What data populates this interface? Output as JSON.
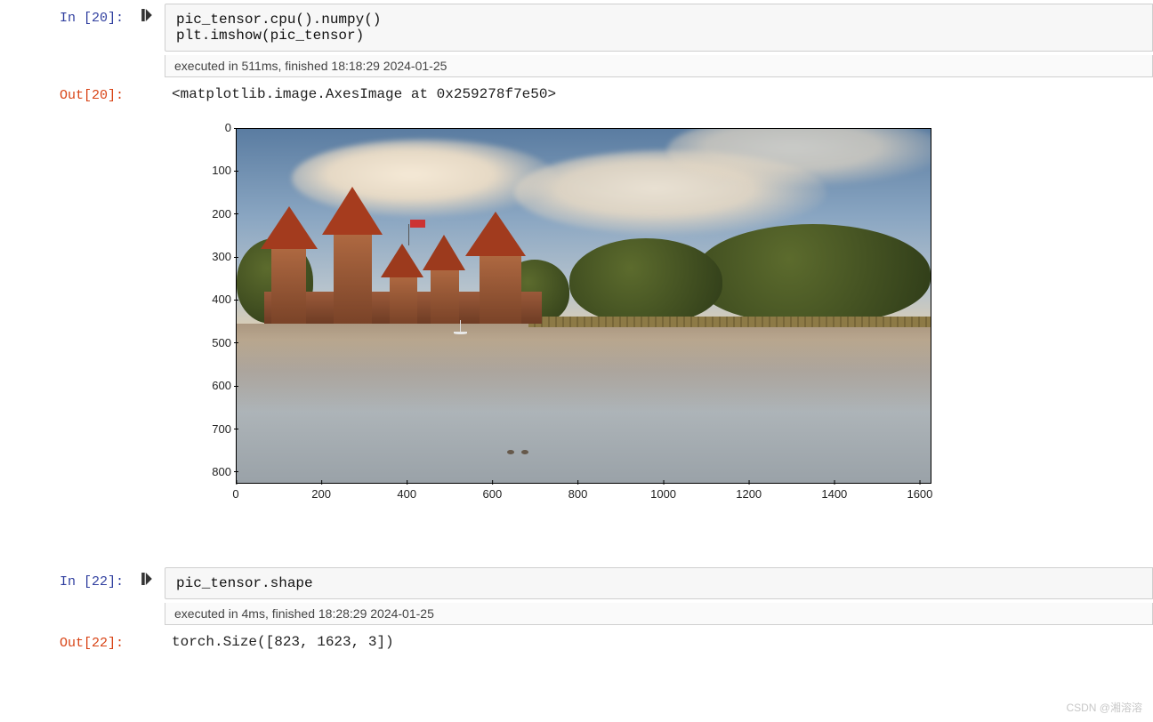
{
  "cells": {
    "c1": {
      "in_prompt": "In  [20]:",
      "code_line1": "pic_tensor.cpu().numpy()",
      "code_line2": "plt.imshow(pic_tensor)",
      "exec_msg": "executed in 511ms, finished 18:18:29 2024-01-25",
      "out_prompt": "Out[20]:",
      "out_text": "<matplotlib.image.AxesImage at 0x259278f7e50>"
    },
    "c2": {
      "in_prompt": "In  [22]:",
      "code_line1": "pic_tensor.shape",
      "exec_msg": "executed in 4ms, finished 18:28:29 2024-01-25",
      "out_prompt": "Out[22]:",
      "out_text": "torch.Size([823, 1623, 3])"
    }
  },
  "plot": {
    "yticks": [
      "0",
      "100",
      "200",
      "300",
      "400",
      "500",
      "600",
      "700",
      "800"
    ],
    "xticks": [
      "0",
      "200",
      "400",
      "600",
      "800",
      "1000",
      "1200",
      "1400",
      "1600"
    ],
    "xmax": 1623,
    "ymax": 823
  },
  "watermark": "CSDN @湘溶溶"
}
